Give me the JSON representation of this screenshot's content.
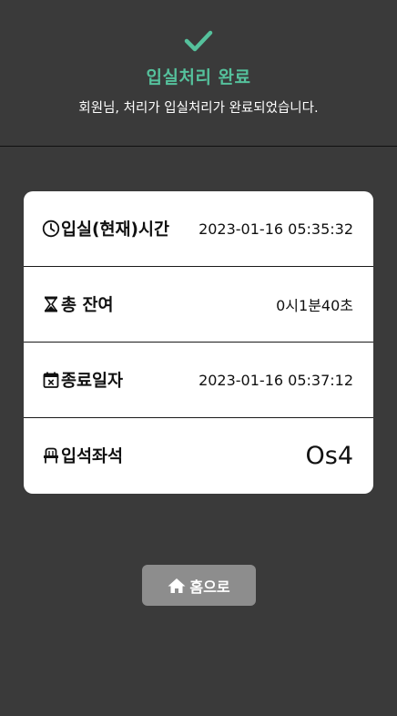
{
  "header": {
    "title": "입실처리 완료",
    "subtitle": "회원님, 처리가 입실처리가 완료되었습니다."
  },
  "colors": {
    "accent": "#55c19c",
    "background": "#3a3a3a",
    "card": "#ffffff",
    "button": "#8d8d8d"
  },
  "rows": [
    {
      "icon": "clock-icon",
      "label": "입실(현재)시간",
      "value": "2023-01-16 05:35:32"
    },
    {
      "icon": "hourglass-icon",
      "label": "총 잔여",
      "value": "0시1분40초"
    },
    {
      "icon": "calendar-x-icon",
      "label": "종료일자",
      "value": "2023-01-16 05:37:12"
    },
    {
      "icon": "seat-icon",
      "label": "입석좌석",
      "value": "Os4"
    }
  ],
  "home_button": {
    "icon": "home-icon",
    "label": "홈으로"
  }
}
